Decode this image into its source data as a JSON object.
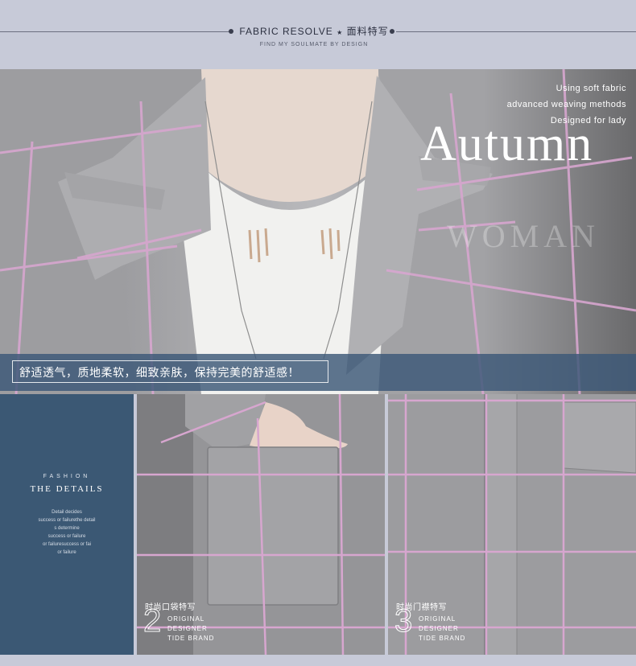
{
  "header": {
    "title": "FABRIC RESOLVE",
    "title_cn": "面料特写",
    "star": "★",
    "subtitle": "FIND MY SOULMATE BY DESIGN"
  },
  "hero": {
    "lines": [
      "Using soft fabric",
      "advanced weaving methods",
      "Designed for lady"
    ],
    "big_word": "Autumn",
    "shadow_word": "WOMAN",
    "banner_text": "舒适透气，质地柔软，细致亲肤，保持完美的舒适感！"
  },
  "details": {
    "kicker": "FASHION",
    "title": "THE DETAILS",
    "body": [
      "Detail decides",
      "success or failurethe detail",
      "s determine",
      "success or failure",
      "or failuresuccess or fai",
      "or failure"
    ]
  },
  "panels": [
    {
      "caption_cn": "时尚口袋特写",
      "number": "2",
      "lines": [
        "ORIGINAL",
        "DESIGNER",
        "TIDE BRAND"
      ]
    },
    {
      "caption_cn": "时尚门襟特写",
      "number": "3",
      "lines": [
        "ORIGINAL",
        "DESIGNER",
        "TIDE BRAND"
      ]
    }
  ],
  "colors": {
    "header_bg": "#c7cad8",
    "coat_grey": "#9a9a9d",
    "check_pink": "#d7a6cf",
    "detail_blue": "#3b5874",
    "banner_blue": "#3c5878"
  }
}
